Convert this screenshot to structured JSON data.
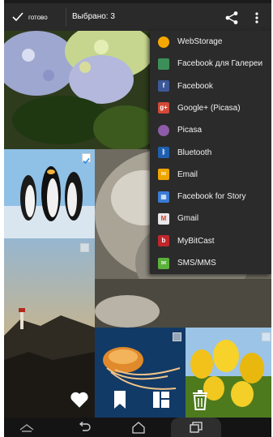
{
  "action_bar": {
    "done_label": "готово",
    "selection_title": "Выбрано: 3"
  },
  "share_menu": {
    "items": [
      {
        "label": "WebStorage",
        "icon": "webstorage-icon",
        "color": "#f6a800"
      },
      {
        "label": "Facebook для Галереи",
        "icon": "gallery-image-icon",
        "color": "#3c8f58"
      },
      {
        "label": "Facebook",
        "icon": "facebook-icon",
        "color": "#3b5998"
      },
      {
        "label": "Google+ (Picasa)",
        "icon": "google-plus-icon",
        "color": "#d34836"
      },
      {
        "label": "Picasa",
        "icon": "picasa-icon",
        "color": "#8e5ba8"
      },
      {
        "label": "Bluetooth",
        "icon": "bluetooth-icon",
        "color": "#1f5fb0"
      },
      {
        "label": "Email",
        "icon": "email-icon",
        "color": "#f0a500"
      },
      {
        "label": "Facebook for Story",
        "icon": "facebook-story-icon",
        "color": "#3a7bd5"
      },
      {
        "label": "Gmail",
        "icon": "gmail-icon",
        "color": "#e8e8e8"
      },
      {
        "label": "MyBitCast",
        "icon": "mybitcast-icon",
        "color": "#c0272d"
      },
      {
        "label": "SMS/MMS",
        "icon": "sms-icon",
        "color": "#5ab23a"
      }
    ]
  },
  "photos": [
    {
      "subject": "hydrangea",
      "selected": false
    },
    {
      "subject": "penguins",
      "selected": true
    },
    {
      "subject": "koala",
      "selected": false
    },
    {
      "subject": "lighthouse",
      "selected": false
    },
    {
      "subject": "jellyfish",
      "selected": false
    },
    {
      "subject": "tulips",
      "selected": false
    }
  ],
  "toolbar": {
    "icons": [
      "heart-icon",
      "bookmark-icon",
      "layout-icon",
      "trash-icon"
    ]
  },
  "navigation": {
    "icons": [
      "home-up-icon",
      "back-icon",
      "home-icon",
      "recent-apps-icon"
    ]
  }
}
